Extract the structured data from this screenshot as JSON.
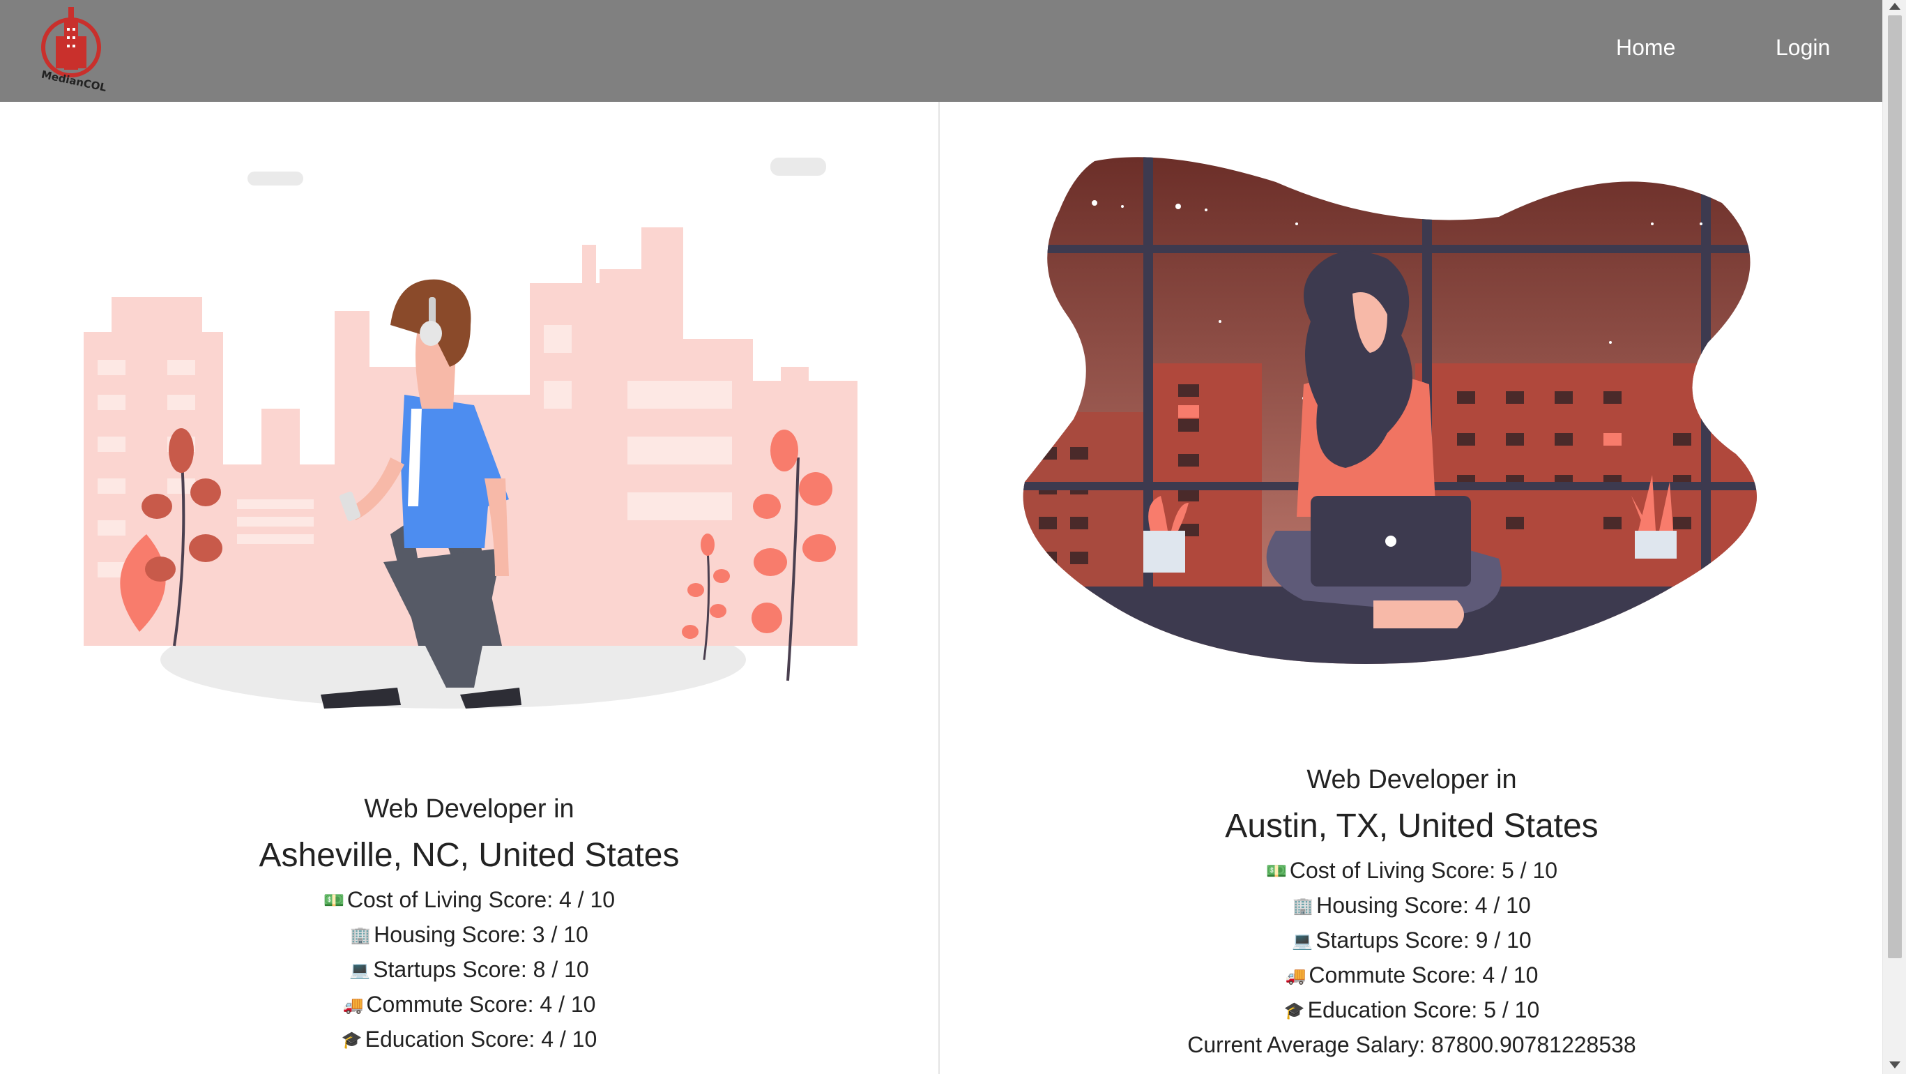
{
  "nav": {
    "logo_text": "MedianCOL",
    "home": "Home",
    "login": "Login"
  },
  "left": {
    "role": "Web Developer in",
    "city": "Asheville, NC, United States",
    "scores": [
      {
        "icon": "money-icon",
        "label": "Cost of Living Score: 4 / 10"
      },
      {
        "icon": "building-icon",
        "label": "Housing Score: 3 / 10"
      },
      {
        "icon": "terminal-icon",
        "label": "Startups Score: 8 / 10"
      },
      {
        "icon": "truck-icon",
        "label": "Commute Score: 4 / 10"
      },
      {
        "icon": "graduation-cap-icon",
        "label": "Education Score: 4 / 10"
      }
    ]
  },
  "right": {
    "role": "Web Developer in",
    "city": "Austin, TX, United States",
    "scores": [
      {
        "icon": "money-icon",
        "label": "Cost of Living Score: 5 / 10"
      },
      {
        "icon": "building-icon",
        "label": "Housing Score: 4 / 10"
      },
      {
        "icon": "terminal-icon",
        "label": "Startups Score: 9 / 10"
      },
      {
        "icon": "truck-icon",
        "label": "Commute Score: 4 / 10"
      },
      {
        "icon": "graduation-cap-icon",
        "label": "Education Score: 5 / 10"
      }
    ],
    "salary": "Current Average Salary: 87800.90781228538"
  },
  "colors": {
    "navbar": "#808080",
    "logo_red": "#c9302c",
    "city_pink": "#fbd5d0",
    "accent_coral": "#f87c6c",
    "shirt_blue": "#4d8df0",
    "night_sky": "#7a3a30",
    "navy": "#3d3a4f"
  }
}
